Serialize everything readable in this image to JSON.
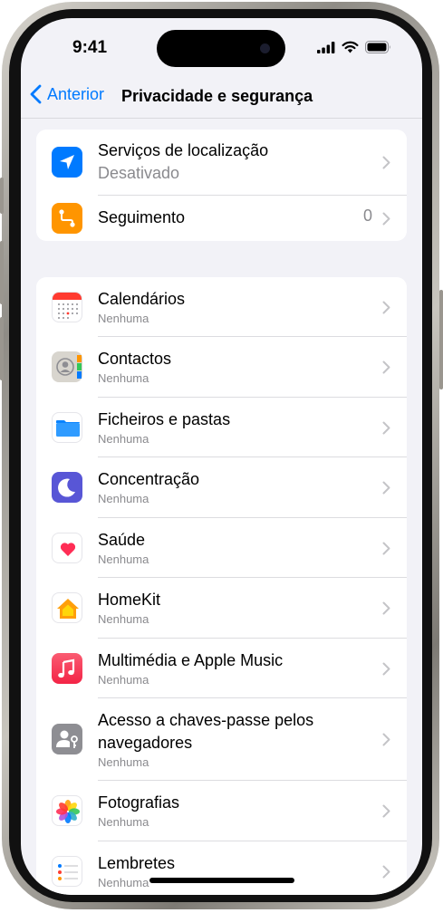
{
  "status_bar": {
    "time": "9:41"
  },
  "nav": {
    "back_label": "Anterior",
    "title": "Privacidade e segurança"
  },
  "top_group": [
    {
      "icon": "location-arrow-icon",
      "label": "Serviços de localização",
      "value": "Desativado",
      "color": "#007aff"
    },
    {
      "icon": "tracking-icon",
      "label": "Seguimento",
      "count": "0",
      "color": "#ff9500"
    }
  ],
  "apps": [
    {
      "icon": "calendar-icon",
      "label": "Calendários",
      "sub": "Nenhuma"
    },
    {
      "icon": "contacts-icon",
      "label": "Contactos",
      "sub": "Nenhuma"
    },
    {
      "icon": "folder-icon",
      "label": "Ficheiros e pastas",
      "sub": "Nenhuma"
    },
    {
      "icon": "focus-moon-icon",
      "label": "Concentração",
      "sub": "Nenhuma"
    },
    {
      "icon": "health-heart-icon",
      "label": "Saúde",
      "sub": "Nenhuma"
    },
    {
      "icon": "homekit-house-icon",
      "label": "HomeKit",
      "sub": "Nenhuma"
    },
    {
      "icon": "music-note-icon",
      "label": "Multimédia e Apple Music",
      "sub": "Nenhuma"
    },
    {
      "icon": "passkey-person-icon",
      "label_line1": "Acesso a chaves-passe pelos",
      "label_line2": "navegadores",
      "sub": "Nenhuma"
    },
    {
      "icon": "photos-flower-icon",
      "label": "Fotografias",
      "sub": "Nenhuma"
    },
    {
      "icon": "reminders-list-icon",
      "label": "Lembretes",
      "sub": "Nenhuma"
    }
  ],
  "colors": {
    "accent": "#007aff",
    "background": "#f2f2f7",
    "secondary_text": "#8a8a8e"
  }
}
